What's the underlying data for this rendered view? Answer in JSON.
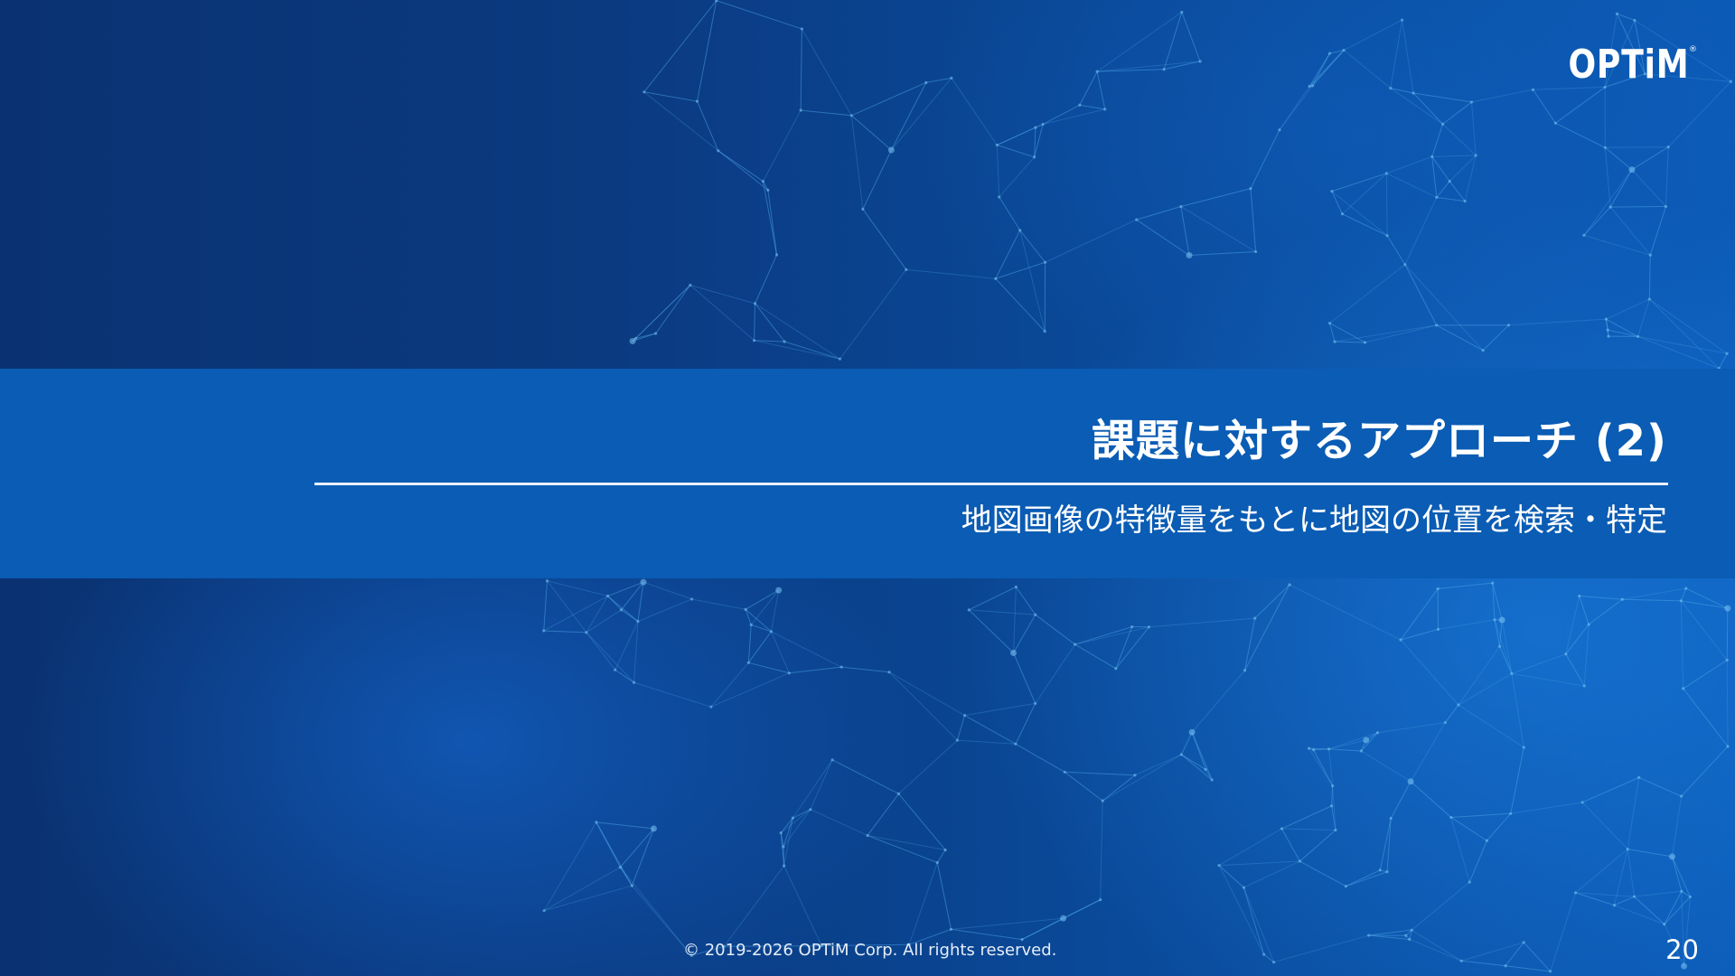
{
  "slide": {
    "logo_text": "OPTiM",
    "logo_registered": "®",
    "title": "課題に対するアプローチ (2)",
    "subtitle": "地図画像の特徴量をもとに地図の位置を検索・特定",
    "copyright": "© 2019-2026 OPTiM Corp. All rights reserved.",
    "page_number": "20"
  },
  "colors": {
    "background_dark": "#0a3272",
    "background_light": "#0b5bb6",
    "band": "#0a5cb4",
    "text": "#ffffff"
  }
}
